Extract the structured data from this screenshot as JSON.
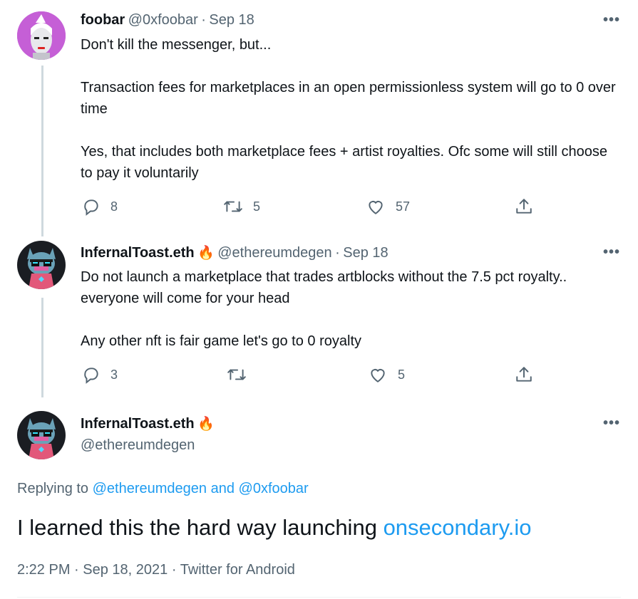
{
  "tweets": [
    {
      "name": "foobar",
      "handle": "@0xfoobar",
      "separator": "·",
      "date": "Sep 18",
      "text": "Don't kill the messenger, but...\n\nTransaction fees for marketplaces in an open permissionless system will go to 0 over time\n\nYes, that includes both marketplace fees + artist royalties. Ofc some will still choose to pay it voluntarily",
      "replies": "8",
      "retweets": "5",
      "likes": "57"
    },
    {
      "name": "InfernalToast.eth",
      "emoji": "🔥",
      "handle": "@ethereumdegen",
      "separator": "·",
      "date": "Sep 18",
      "text": "Do not launch a marketplace that trades artblocks without the 7.5 pct royalty.. everyone will come for your head\n\nAny other nft is fair game let's go to 0 royalty",
      "replies": "3",
      "retweets": "",
      "likes": "5"
    }
  ],
  "focus": {
    "name": "InfernalToast.eth",
    "emoji": "🔥",
    "handle": "@ethereumdegen",
    "replying_prefix": "Replying to",
    "replying_user1": "@ethereumdegen",
    "replying_and": "and",
    "replying_user2": "@0xfoobar",
    "text": "I learned this the hard way launching",
    "link": "onsecondary.io",
    "time": "2:22 PM",
    "separator": "·",
    "date": "Sep 18, 2021",
    "source": "Twitter for Android"
  },
  "more_label": "•••",
  "colors": {
    "accent": "#1d9bf0",
    "muted": "#536471",
    "line": "#cfd9de"
  },
  "icons": [
    "reply-icon",
    "retweet-icon",
    "like-icon",
    "share-icon",
    "more-icon",
    "fire-emoji"
  ]
}
